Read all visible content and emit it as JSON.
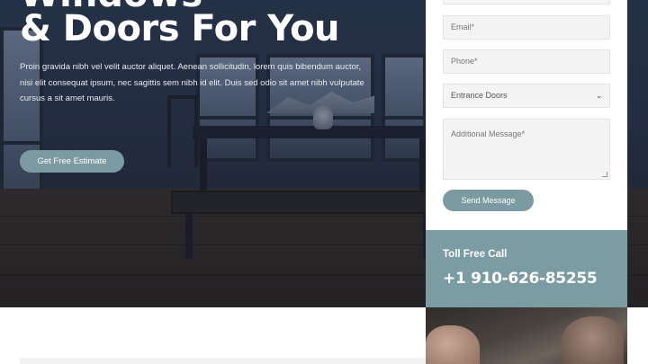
{
  "hero": {
    "title_line_top": "Windows",
    "title_line": "& Doors For You",
    "description": "Proin gravida nibh vel velit auctor aliquet. Aenean sollicitudin, lorem quis bibendum auctor, nisi elit consequat ipsum, nec sagittis sem nibh id elit. Duis sed odio sit amet nibh vulputate cursus a sit amet mauris.",
    "cta_label": "Get Free Estimate"
  },
  "form": {
    "email_placeholder": "Email*",
    "phone_placeholder": "Phone*",
    "select_value": "Entrance Doors",
    "message_placeholder": "Additional Message*",
    "send_label": "Send Message"
  },
  "toll_free": {
    "label": "Toll Free Call",
    "number": "+1 910-626-85255"
  },
  "colors": {
    "accent": "#7b9aa2",
    "toll_bg": "#7b9ca3"
  }
}
